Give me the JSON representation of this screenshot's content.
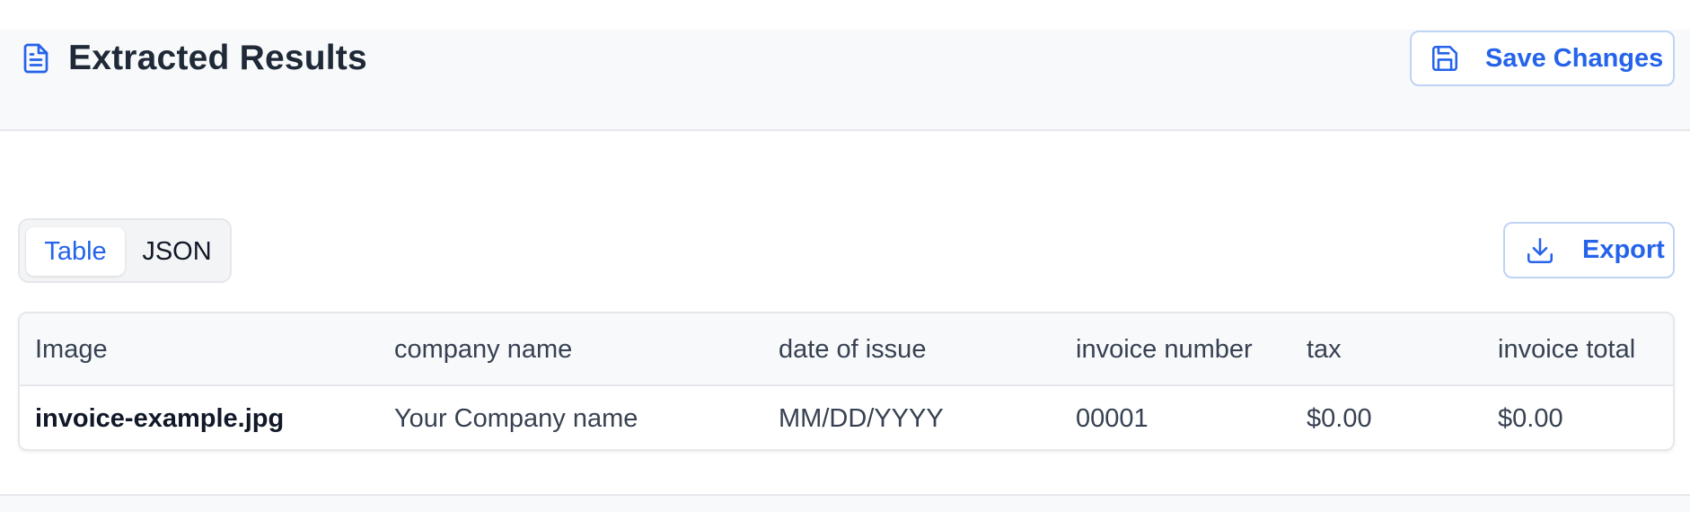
{
  "header": {
    "title": "Extracted Results",
    "title_icon": "document-icon",
    "save_label": "Save Changes",
    "save_icon": "floppy-disk-icon"
  },
  "toolbar": {
    "view_options": [
      "Table",
      "JSON"
    ],
    "selected_view": "Table",
    "export_label": "Export",
    "export_icon": "download-icon"
  },
  "table": {
    "columns": [
      "Image",
      "company name",
      "date of issue",
      "invoice number",
      "tax",
      "invoice total"
    ],
    "rows": [
      [
        "invoice-example.jpg",
        "Your Company name",
        "MM/DD/YYYY",
        "00001",
        "$0.00",
        "$0.00"
      ]
    ]
  },
  "colors": {
    "accent": "#2563eb",
    "text": "#1f2937",
    "header_bg": "#f8f9fb",
    "border": "#e5e7eb"
  }
}
